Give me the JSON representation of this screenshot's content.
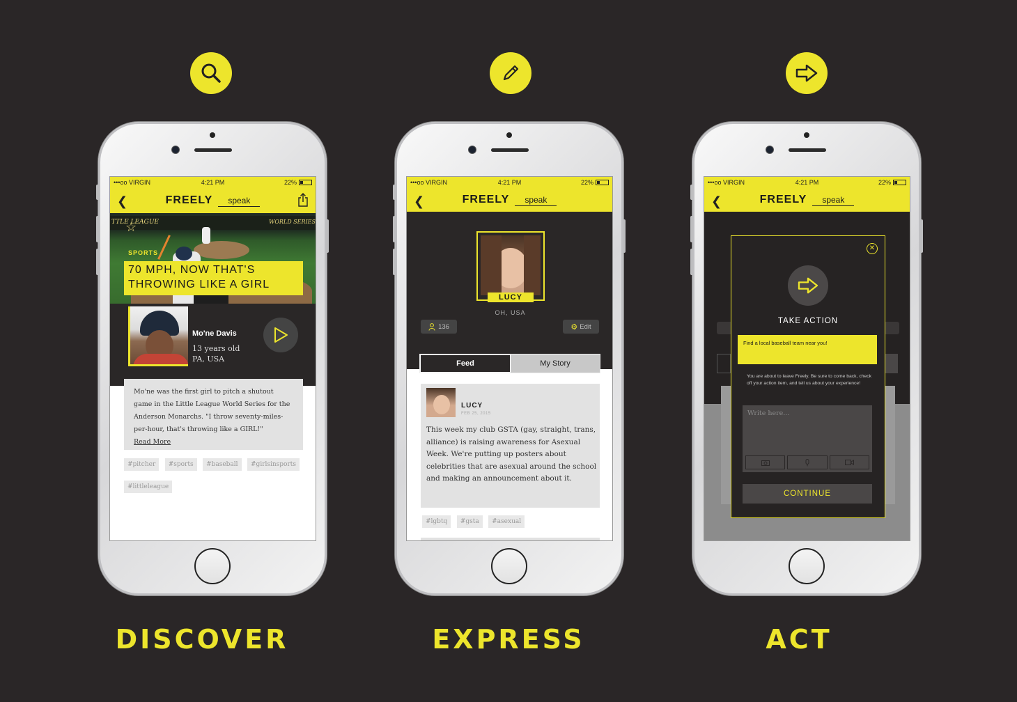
{
  "colors": {
    "accent": "#ede52c",
    "background": "#2a2627",
    "dark": "#2a2727"
  },
  "status_bar": {
    "carrier": "•••oo VIRGIN",
    "time": "4:21 PM",
    "battery": "22%"
  },
  "app": {
    "brand": "FREELY",
    "speak": "speak"
  },
  "sections": [
    {
      "caption": "DISCOVER",
      "icon": "search-icon"
    },
    {
      "caption": "EXPRESS",
      "icon": "pencil-icon"
    },
    {
      "caption": "ACT",
      "icon": "arrow-right-icon"
    }
  ],
  "discover": {
    "hero_text_left": "TTLE LEAGUE",
    "hero_text_right": "WORLD SERIES",
    "category": "SPORTS",
    "headline_1": "70 MPH, NOW THAT'S",
    "headline_2": "THROWING LIKE A GIRL",
    "person_name": "Mo'ne Davis",
    "person_age": "13 years old",
    "person_location": "PA, USA",
    "body": "Mo'ne was the first girl to pitch a shutout game in the Little League World Series for the Anderson Monarchs. \"I throw seventy-miles-per-hour, that's throwing like a GIRL!\"",
    "read_more": "Read More",
    "tags": [
      "#pitcher",
      "#sports",
      "#baseball",
      "#girlsinsports",
      "#littleleague"
    ]
  },
  "express": {
    "profile_name": "LUCY",
    "location": "OH, USA",
    "followers": "136",
    "edit_label": "Edit",
    "tab_feed": "Feed",
    "tab_story": "My Story",
    "post_author": "LUCY",
    "post_date": "FEB 25, 2015",
    "post_body": "This week my club GSTA (gay, straight, trans, alliance) is raising awareness for Asexual Week. We're putting up posters about celebrities that are asexual around the school and making an announcement about it.",
    "tags": [
      "#lgbtq",
      "#gsta",
      "#asexual"
    ]
  },
  "act": {
    "title": "TAKE ACTION",
    "action_item": "Find a local baseball team near you!",
    "notice": "You are about to leave Freely. Be sure to come back, check off your action item, and tell us about your experience!",
    "placeholder": "Write here...",
    "continue_label": "CONTINUE"
  }
}
